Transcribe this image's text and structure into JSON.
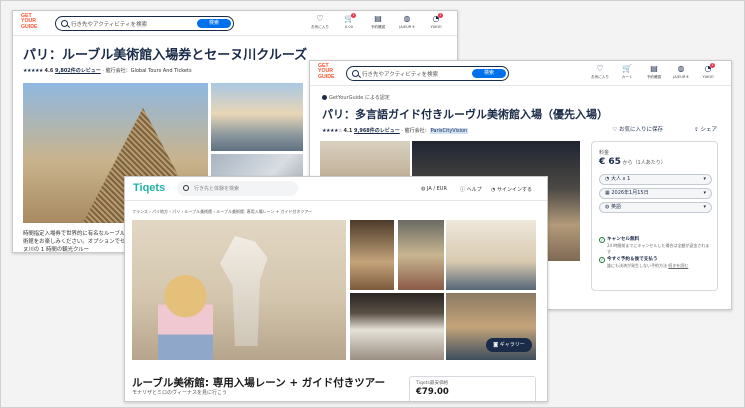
{
  "back_window": {
    "logo": "GET YOUR GUIDE",
    "search_placeholder": "行き先やアクティビティを検索",
    "search_button": "検索",
    "nav": [
      {
        "icon": "heart-icon",
        "glyph": "♡",
        "label": "お気に入り"
      },
      {
        "icon": "cart-icon",
        "glyph": "🛒",
        "label": "0.00",
        "badge": "1"
      },
      {
        "icon": "booking-icon",
        "glyph": "▤",
        "label": "予約確認"
      },
      {
        "icon": "globe-icon",
        "glyph": "◍",
        "label": "JA/EUR €"
      },
      {
        "icon": "user-icon",
        "glyph": "◔",
        "label": "YUKIO",
        "badge": "1"
      }
    ],
    "title": "パリ：ルーブル美術館入場券とセーヌ川クルーズ",
    "rating_value": "4.6",
    "review_link": "9,802件のレビュー",
    "provider_label": "催行会社：",
    "provider": "Global Tours And Tickets",
    "description": "時間指定入場券で世界的に有名なルーブル美術館をお楽しみください。オプションでセーヌ川の 1 時間の観光クルー"
  },
  "middle_window": {
    "logo": "GET YOUR GUIDE",
    "search_placeholder": "行き先やアクティビティを検索",
    "search_button": "検索",
    "nav": [
      {
        "icon": "heart-icon",
        "glyph": "♡",
        "label": "お気に入り"
      },
      {
        "icon": "cart-icon",
        "glyph": "🛒",
        "label": "カート"
      },
      {
        "icon": "booking-icon",
        "glyph": "▤",
        "label": "予約確認"
      },
      {
        "icon": "globe-icon",
        "glyph": "◍",
        "label": "JA/EUR €"
      },
      {
        "icon": "user-icon",
        "glyph": "◔",
        "label": "YUKIO",
        "badge": "1"
      }
    ],
    "verified_by": "GetYourGuide による認定",
    "title": "パリ：多言語ガイド付きルーヴル美術館入場（優先入場）",
    "rating_value": "4.1",
    "review_link": "9,968件のレビュー",
    "provider_label": "催行会社：",
    "provider": "ParisCityVision",
    "save_label": "お気に入りに保存",
    "share_label": "シェア",
    "booking": {
      "from_label": "料金",
      "price": "€ 65",
      "price_suffix": "から（1人あたり）",
      "participants": "大人 x 1",
      "date": "2026年1月15日",
      "language": "英語",
      "free_cancel_title": "キャンセル無料",
      "free_cancel_text": "24 時間前までにキャンセルした場合は全額が返金されます",
      "reserve_title": "今すぐ予約＆後で支払う",
      "reserve_text": "誰にも決済が発生しない予約方法",
      "reserve_link": "続きを読む"
    }
  },
  "front_window": {
    "logo": "Tiqets",
    "search_placeholder": "行き先と体験を検索",
    "nav_locale": "JA / EUR",
    "nav_help": "ヘルプ",
    "nav_signin": "サインインする",
    "breadcrumb": "フランス › パリ地方 › パリ › ルーブル美術館 › ルーブル美術館: 専用入場レーン + ガイド付きツアー",
    "gallery_button": "ギャラリー",
    "title": "ルーブル美術館: 専用入場レーン + ガイド付きツアー",
    "subtitle": "モナリザとミロのヴィーナスを見に行こう",
    "price_label": "Tiqets最安価格",
    "price": "€79.00"
  }
}
